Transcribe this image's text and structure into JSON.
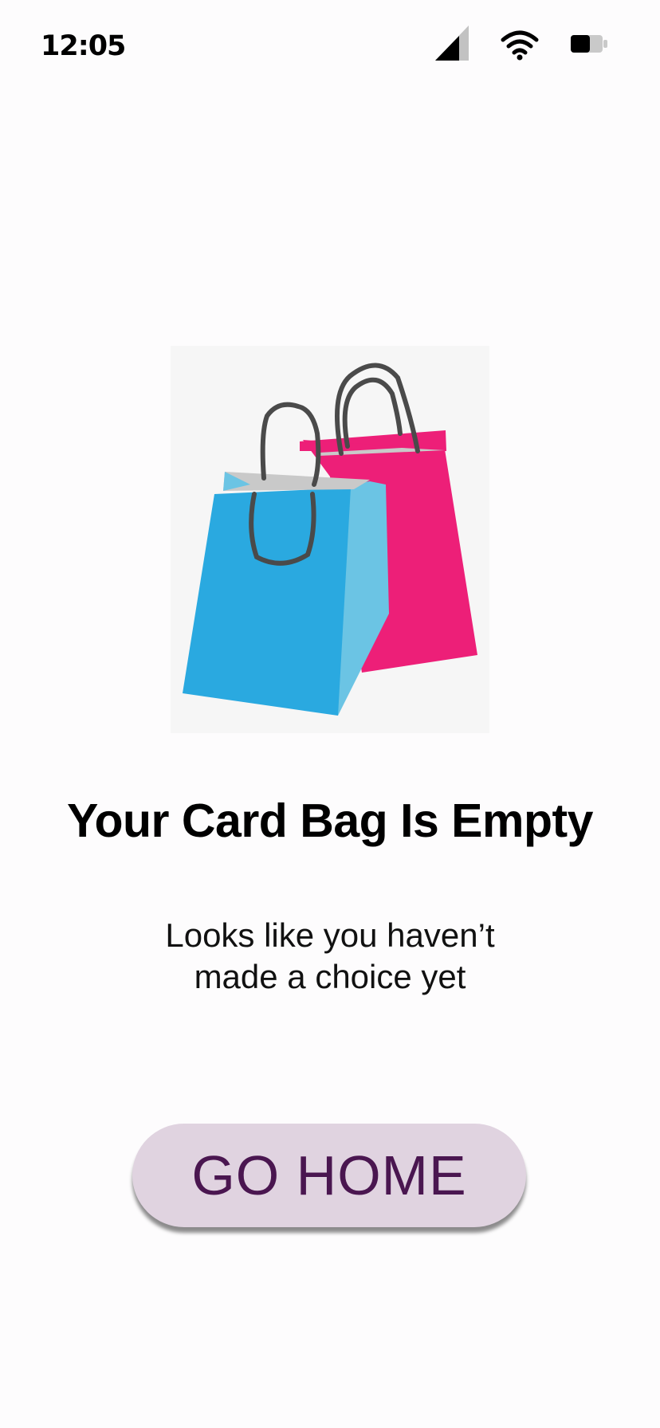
{
  "status_bar": {
    "time": "12:05",
    "icons": [
      "signal-icon",
      "wifi-icon",
      "battery-icon"
    ]
  },
  "illustration": {
    "name": "shopping-bags-illustration",
    "colors": {
      "blue_bag": "#2aa9e0",
      "blue_bag_side": "#6bc4e4",
      "pink_bag": "#ed1f78",
      "handle": "#4a4a4a",
      "background": "#f6f6f6"
    }
  },
  "empty_state": {
    "title": "Your Card Bag Is Empty",
    "subtitle_line1": "Looks like you haven’t",
    "subtitle_line2": "made a choice yet"
  },
  "actions": {
    "go_home_label": "GO HOME"
  },
  "colors": {
    "button_bg": "#e0d3e0",
    "button_text": "#4a1650"
  }
}
